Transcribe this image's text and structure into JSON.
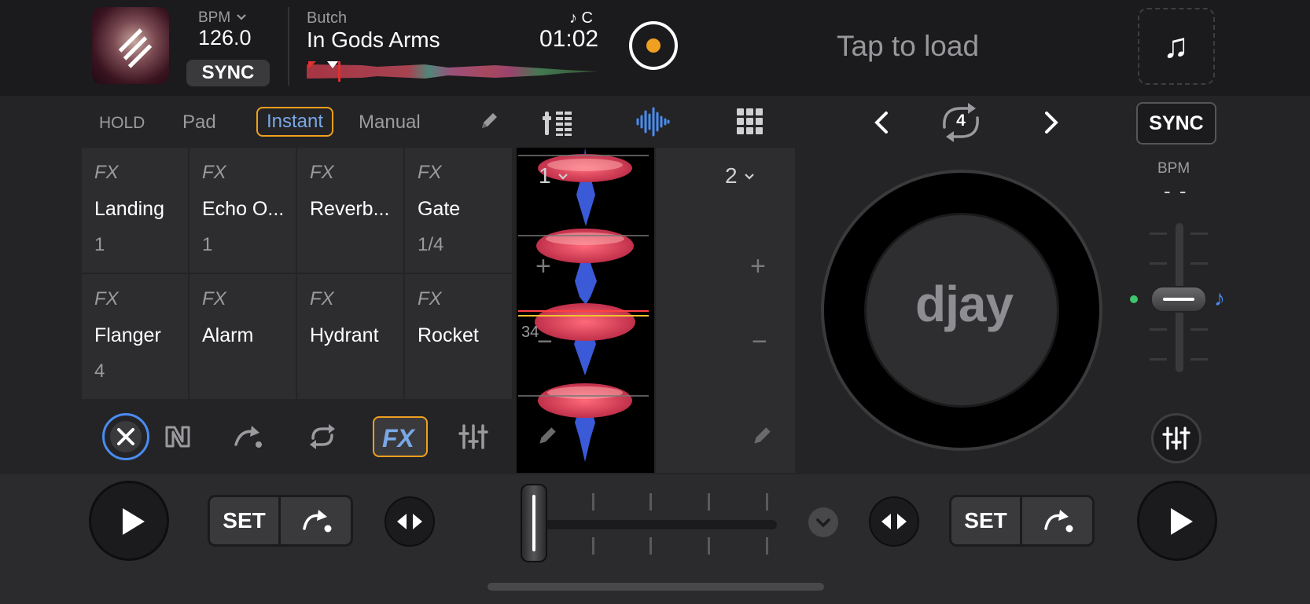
{
  "deck1": {
    "bpm_label": "BPM",
    "bpm_value": "126.0",
    "sync_label": "SYNC",
    "artist": "Butch",
    "title": "In Gods Arms",
    "key": "♪ C",
    "time": "01:02"
  },
  "deck2": {
    "load_prompt": "Tap to load",
    "sync_label": "SYNC",
    "bpm_label": "BPM",
    "bpm_value": "- -",
    "loop_count": "4",
    "platter_logo": "djay"
  },
  "modes": {
    "hold": "HOLD",
    "pad": "Pad",
    "instant": "Instant",
    "manual": "Manual"
  },
  "fx_pads": [
    {
      "tag": "FX",
      "name": "Landing",
      "value": "1"
    },
    {
      "tag": "FX",
      "name": "Echo O...",
      "value": "1"
    },
    {
      "tag": "FX",
      "name": "Reverb...",
      "value": ""
    },
    {
      "tag": "FX",
      "name": "Gate",
      "value": "1/4"
    },
    {
      "tag": "FX",
      "name": "Flanger",
      "value": "4"
    },
    {
      "tag": "FX",
      "name": "Alarm",
      "value": ""
    },
    {
      "tag": "FX",
      "name": "Hydrant",
      "value": ""
    },
    {
      "tag": "FX",
      "name": "Rocket",
      "value": ""
    }
  ],
  "fx_toolbar": {
    "fx_label": "FX"
  },
  "waveform": {
    "deck1_label": "1",
    "deck2_label": "2",
    "beat_number": "34",
    "plus": "+",
    "minus": "−"
  },
  "bottom": {
    "left_set": "SET",
    "right_set": "SET"
  },
  "colors": {
    "accent_orange": "#f0a020",
    "accent_blue": "#4a8cf0",
    "background": "#242426"
  }
}
